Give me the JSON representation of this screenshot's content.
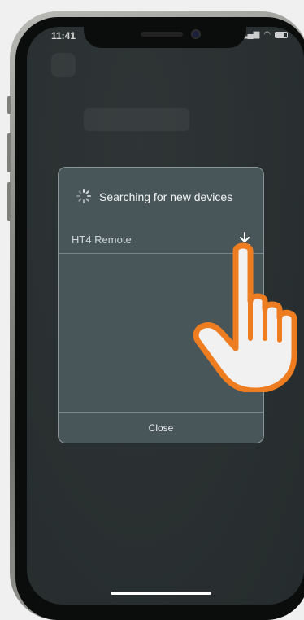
{
  "status_bar": {
    "time": "11:41"
  },
  "dialog": {
    "title": "Searching for new devices",
    "devices": [
      {
        "name": "HT4 Remote"
      }
    ],
    "close_label": "Close"
  },
  "icons": {
    "spinner": "loading-spinner-icon",
    "download": "download-icon",
    "pointer": "hand-pointer-icon"
  },
  "colors": {
    "screen_bg": "#2a3132",
    "dialog_bg": "#48565a",
    "hand_outline": "#ee7d22"
  }
}
